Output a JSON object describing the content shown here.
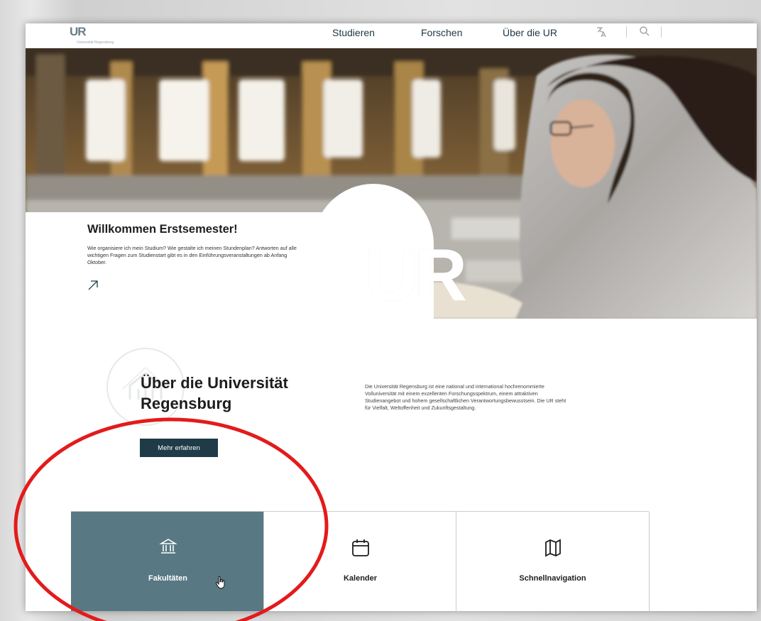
{
  "header": {
    "logo_mark": "UR",
    "logo_sub": "Universität Regensburg",
    "nav": [
      {
        "label": "Studieren"
      },
      {
        "label": "Forschen"
      },
      {
        "label": "Über die UR"
      }
    ],
    "icons": [
      "language-icon",
      "search-icon"
    ]
  },
  "hero": {
    "ur_text": "UR",
    "welcome_title": "Willkommen Erstsemester!",
    "welcome_text": "Wie organisiere ich mein Studium? Wie gestalte ich meinen Stundenplan? Antworten auf alle wichtigen Fragen zum Studienstart gibt es in den Einführungsveranstaltungen ab Anfang Oktober."
  },
  "about": {
    "title": "Über die Universität Regensburg",
    "button_label": "Mehr erfahren",
    "text": "Die Universität Regensburg ist eine national und international hochrenommierte Volluniversität mit einem exzellenten Forschungsspektrum, einem attraktiven Studienangebot und hohem gesellschaftlichen Verantwortungsbewusstsein. Die UR steht für Vielfalt, Weltoffenheit und Zukunftsgestaltung."
  },
  "tiles": [
    {
      "label": "Fakultäten",
      "icon": "institution-icon",
      "active": true
    },
    {
      "label": "Kalender",
      "icon": "calendar-icon",
      "active": false
    },
    {
      "label": "Schnellnavigation",
      "icon": "map-icon",
      "active": false
    }
  ],
  "colors": {
    "primary_dark": "#1f3b48",
    "tile_active": "#587883",
    "annotation_red": "#e31b1b"
  }
}
